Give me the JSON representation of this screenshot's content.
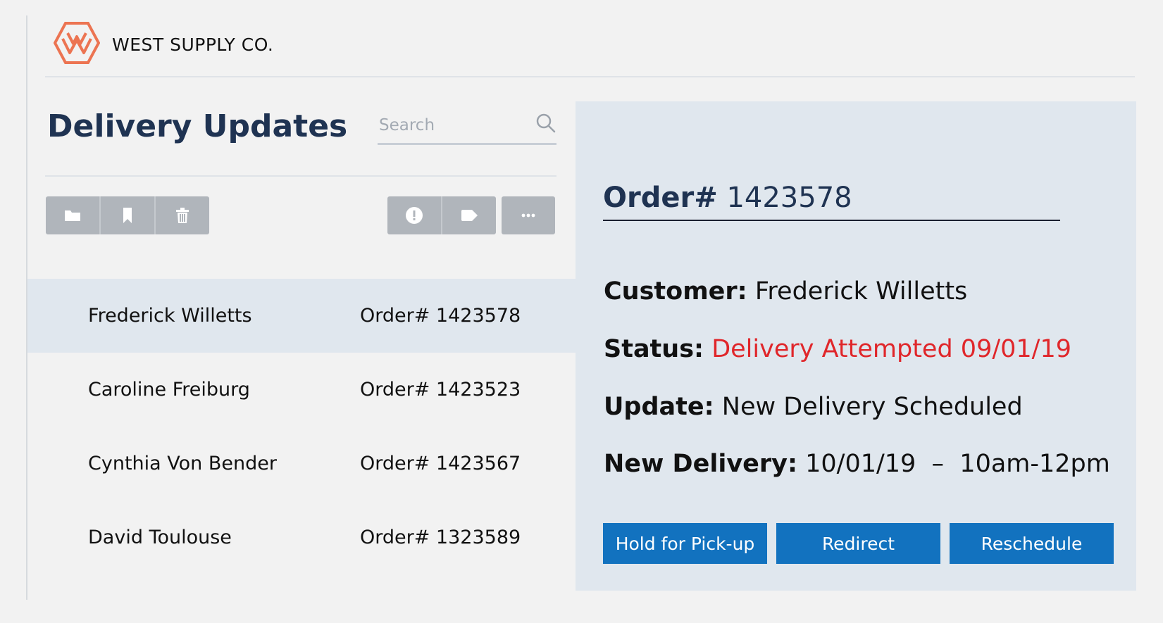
{
  "brand": {
    "name": "WEST SUPPLY CO.",
    "logo_icon": "hexagon-w-logo",
    "accent": "#ec7452"
  },
  "page": {
    "title": "Delivery Updates"
  },
  "search": {
    "placeholder": "Search",
    "value": "",
    "icon": "search-icon"
  },
  "toolbar": {
    "left_group": [
      {
        "icon": "folder-icon"
      },
      {
        "icon": "bookmark-icon"
      },
      {
        "icon": "trash-icon"
      }
    ],
    "right_group": [
      {
        "icon": "alert-icon"
      },
      {
        "icon": "tag-icon"
      }
    ],
    "more": {
      "icon": "more-icon"
    }
  },
  "orders": [
    {
      "name": "Frederick Willetts",
      "order": "Order# 1423578",
      "selected": true
    },
    {
      "name": "Caroline Freiburg",
      "order": "Order# 1423523",
      "selected": false
    },
    {
      "name": "Cynthia Von Bender",
      "order": "Order# 1423567",
      "selected": false
    },
    {
      "name": "David Toulouse",
      "order": "Order# 1323589",
      "selected": false
    }
  ],
  "detail": {
    "order_label": "Order#",
    "order_number": "1423578",
    "customer_label": "Customer:",
    "customer_value": "Frederick Willetts",
    "status_label": "Status:",
    "status_value": "Delivery Attempted 09/01/19",
    "status_color": "#e0262a",
    "update_label": "Update:",
    "update_value": "New Delivery Scheduled",
    "new_delivery_label": "New Delivery:",
    "new_delivery_value": "10/01/19  –  10am-12pm",
    "actions": [
      "Hold for Pick-up",
      "Redirect",
      "Reschedule"
    ],
    "action_color": "#1272bf"
  }
}
